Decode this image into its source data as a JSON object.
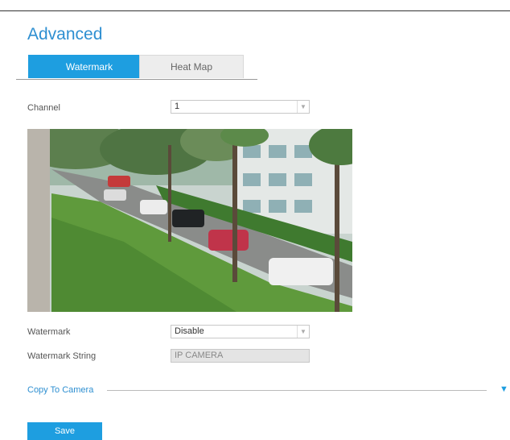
{
  "page": {
    "title": "Advanced"
  },
  "tabs": [
    {
      "label": "Watermark",
      "active": true
    },
    {
      "label": "Heat Map",
      "active": false
    }
  ],
  "channel": {
    "label": "Channel",
    "value": "1"
  },
  "preview": {
    "description_icon": "camera-preview-image"
  },
  "watermark": {
    "label": "Watermark",
    "value": "Disable",
    "string_label": "Watermark String",
    "string_value": "IP CAMERA"
  },
  "copy": {
    "label": "Copy To Camera",
    "icon": "triangle-down-icon"
  },
  "actions": {
    "save_label": "Save"
  },
  "colors": {
    "accent": "#1e9ee0",
    "title": "#2e8fd1"
  }
}
